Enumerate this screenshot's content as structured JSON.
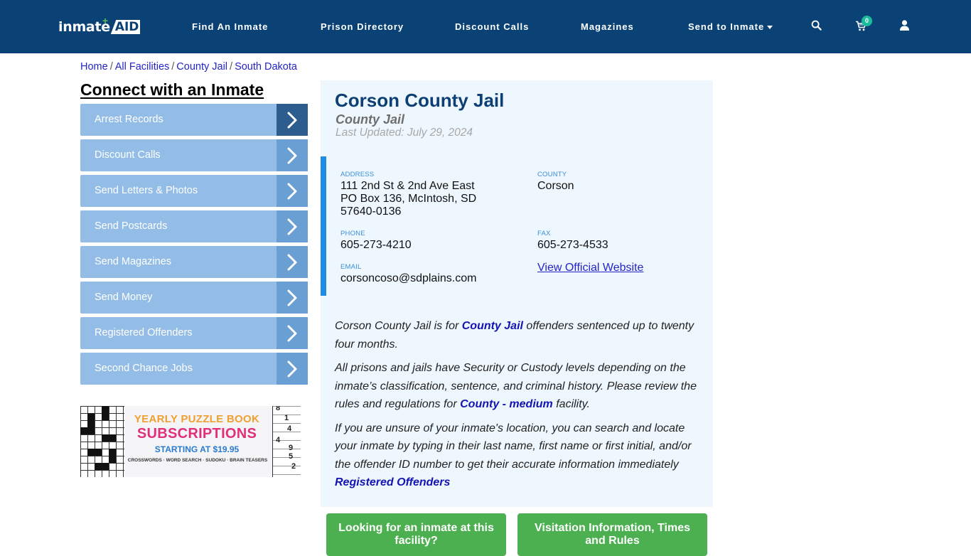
{
  "header": {
    "logo_text": "inmate",
    "logo_accent": "AID",
    "nav": [
      {
        "label": "Find An Inmate"
      },
      {
        "label": "Prison Directory"
      },
      {
        "label": "Discount Calls"
      },
      {
        "label": "Magazines"
      },
      {
        "label": "Send to Inmate",
        "has_dropdown": true
      }
    ],
    "icons": {
      "search": "search-icon",
      "cart": "cart-icon",
      "user": "user-icon"
    },
    "cart_count": "0",
    "colors": {
      "bar": "#0b4275",
      "badge": "#1abc9c"
    }
  },
  "breadcrumb": [
    {
      "label": "Home"
    },
    {
      "label": "All Facilities"
    },
    {
      "label": "County Jail"
    },
    {
      "label": "South Dakota"
    }
  ],
  "sidebar": {
    "title": "Connect with an Inmate",
    "items": [
      {
        "label": "Arrest Records",
        "active": true
      },
      {
        "label": "Discount Calls"
      },
      {
        "label": "Send Letters & Photos"
      },
      {
        "label": "Send Postcards"
      },
      {
        "label": "Send Magazines"
      },
      {
        "label": "Send Money"
      },
      {
        "label": "Registered Offenders"
      },
      {
        "label": "Second Chance Jobs"
      }
    ],
    "ad": {
      "line1": "YEARLY PUZZLE BOOK",
      "line2": "SUBSCRIPTIONS",
      "line3": "STARTING AT $19.95",
      "line4": "CROSSWORDS · WORD SEARCH · SUDOKU · BRAIN TEASERS",
      "sudoku_digits": [
        "8",
        "1",
        "4",
        "4",
        "9",
        "5",
        "2"
      ]
    }
  },
  "facility": {
    "name": "Corson County Jail",
    "type": "County Jail",
    "last_updated": "Last Updated: July 29, 2024",
    "address_label": "ADDRESS",
    "address_lines": [
      "111 2nd St & 2nd Ave East",
      "PO Box 136, McIntosh, SD",
      "57640-0136"
    ],
    "county_label": "COUNTY",
    "county": "Corson",
    "phone_label": "PHONE",
    "phone": "605-273-4210",
    "fax_label": "FAX",
    "fax": "605-273-4533",
    "email_label": "EMAIL",
    "email": "corsoncoso@sdplains.com",
    "website_link": "View Official Website"
  },
  "description": {
    "p1_before": "Corson County Jail is for ",
    "p1_link": "County Jail",
    "p1_after": " offenders sentenced up to twenty four months.",
    "p2_before": "All prisons and jails have Security or Custody levels depending on the inmate’s classification, sentence, and criminal history. Please review the rules and regulations for ",
    "p2_link": "County - medium",
    "p2_after": " facility.",
    "p3_text": "If you are unsure of your inmate's location, you can search and locate your inmate by typing in their last name, first name or first initial, and/or the offender ID number to get their accurate information immediately ",
    "p3_link": "Registered Offenders"
  },
  "actions": {
    "find_inmate": "Looking for an inmate at this facility?",
    "visitation": "Visitation Information, Times and Rules"
  }
}
